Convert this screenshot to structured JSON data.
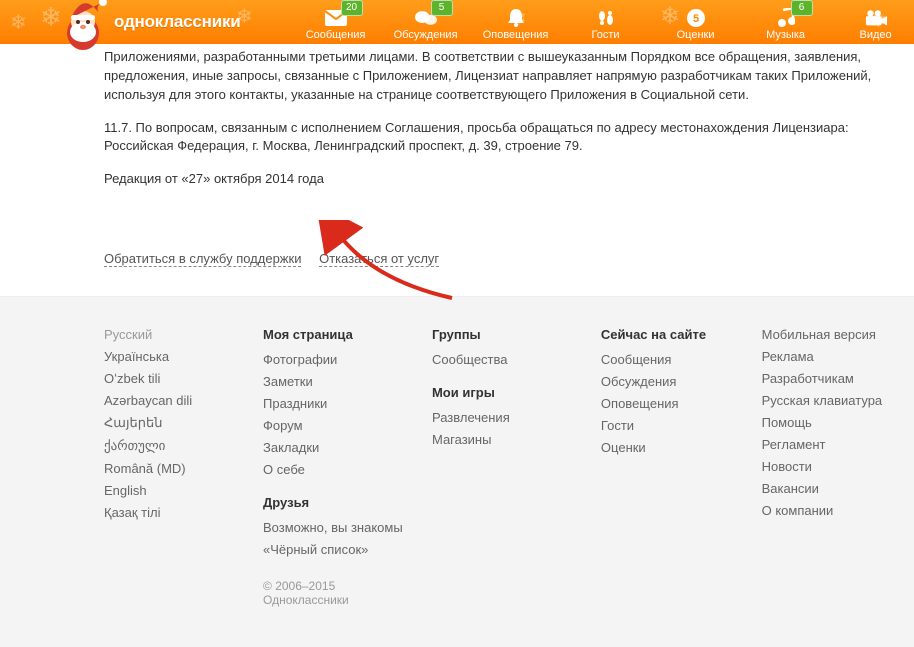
{
  "header": {
    "logo_text": "одноклассники",
    "nav": [
      {
        "label": "Сообщения",
        "badge": "20"
      },
      {
        "label": "Обсуждения",
        "badge": "5"
      },
      {
        "label": "Оповещения",
        "badge": null
      },
      {
        "label": "Гости",
        "badge": null
      },
      {
        "label": "Оценки",
        "badge": null
      },
      {
        "label": "Музыка",
        "badge": "6"
      },
      {
        "label": "Видео",
        "badge": null
      }
    ]
  },
  "content": {
    "p1": "Приложениями, разработанными третьими лицами. В соответствии с вышеуказанным Порядком все обращения, заявления, предложения, иные запросы, связанные с Приложением, Лицензиат направляет напрямую разработчикам таких Приложений, используя для этого контакты, указанные на странице соответствующего Приложения в Социальной сети.",
    "p2": "11.7. По вопросам, связанным с исполнением Соглашения, просьба обращаться по адресу местонахождения Лицензиара: Российская Федерация, г. Москва, Ленинградский проспект, д. 39, строение 79.",
    "p3": "Редакция от «27» октября 2014 года"
  },
  "action_links": {
    "support": "Обратиться в службу поддержки",
    "optout": "Отказаться от услуг"
  },
  "footer": {
    "languages": {
      "current": "Русский",
      "list": [
        "Українська",
        "Oʻzbek tili",
        "Azərbaycan dili",
        "Հայերեն",
        "ქართული",
        "Română (MD)",
        "English",
        "Қазақ тілі"
      ]
    },
    "col2a_head": "Моя страница",
    "col2a": [
      "Фотографии",
      "Заметки",
      "Праздники",
      "Форум",
      "Закладки",
      "О себе"
    ],
    "col2b_head": "Друзья",
    "col2b": [
      "Возможно, вы знакомы",
      "«Чёрный список»"
    ],
    "col3a_head": "Группы",
    "col3a": [
      "Сообщества"
    ],
    "col3b_head": "Мои игры",
    "col3b": [
      "Развлечения",
      "Магазины"
    ],
    "col4_head": "Сейчас на сайте",
    "col4": [
      "Сообщения",
      "Обсуждения",
      "Оповещения",
      "Гости",
      "Оценки"
    ],
    "col5": [
      "Мобильная версия",
      "Реклама",
      "Разработчикам",
      "Русская клавиатура",
      "Помощь",
      "Регламент",
      "Новости",
      "Вакансии",
      "О компании"
    ],
    "copyright": "© 2006–2015 Одноклассники"
  }
}
